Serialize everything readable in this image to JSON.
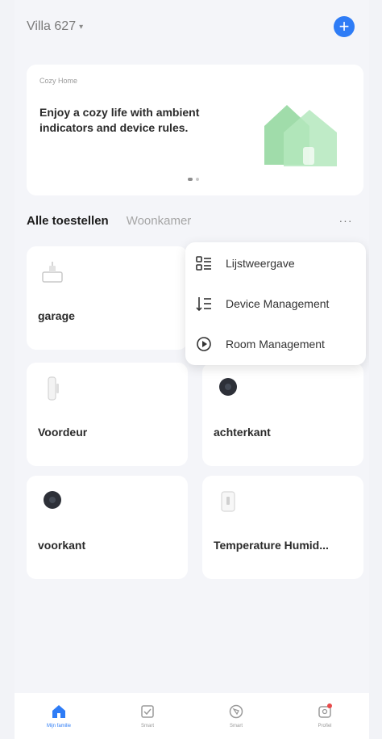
{
  "header": {
    "home_name": "Villa 627",
    "caret": "▾",
    "add_symbol": "+"
  },
  "banner": {
    "tag": "Cozy Home",
    "text": "Enjoy a cozy life with ambient indicators and device rules."
  },
  "tabs": {
    "items": [
      {
        "label": "Alle toestellen"
      },
      {
        "label": "Woonkamer"
      }
    ],
    "more_symbol": "···"
  },
  "menu": {
    "items": [
      {
        "label": "Lijstweergave",
        "icon": "list-view-icon"
      },
      {
        "label": "Device Management",
        "icon": "device-management-icon"
      },
      {
        "label": "Room Management",
        "icon": "room-management-icon"
      }
    ]
  },
  "devices": [
    {
      "name": "garage",
      "icon": "garage-sensor-icon"
    },
    {
      "name": "Voordeur",
      "icon": "door-sensor-icon"
    },
    {
      "name": "achterkant",
      "icon": "camera-icon"
    },
    {
      "name": "voorkant",
      "icon": "camera-icon"
    },
    {
      "name": "Temperature Humid...",
      "icon": "temperature-humidity-icon"
    }
  ],
  "nav": {
    "items": [
      {
        "label": "Mijn familie",
        "icon": "home-icon"
      },
      {
        "label": "Smart",
        "icon": "smart-icon"
      },
      {
        "label": "Smart",
        "icon": "explore-icon"
      },
      {
        "label": "Profiel",
        "icon": "profile-icon"
      }
    ]
  },
  "colors": {
    "accent": "#2e7cf6",
    "background": "#f4f5f9",
    "badge": "#e84a4a"
  }
}
